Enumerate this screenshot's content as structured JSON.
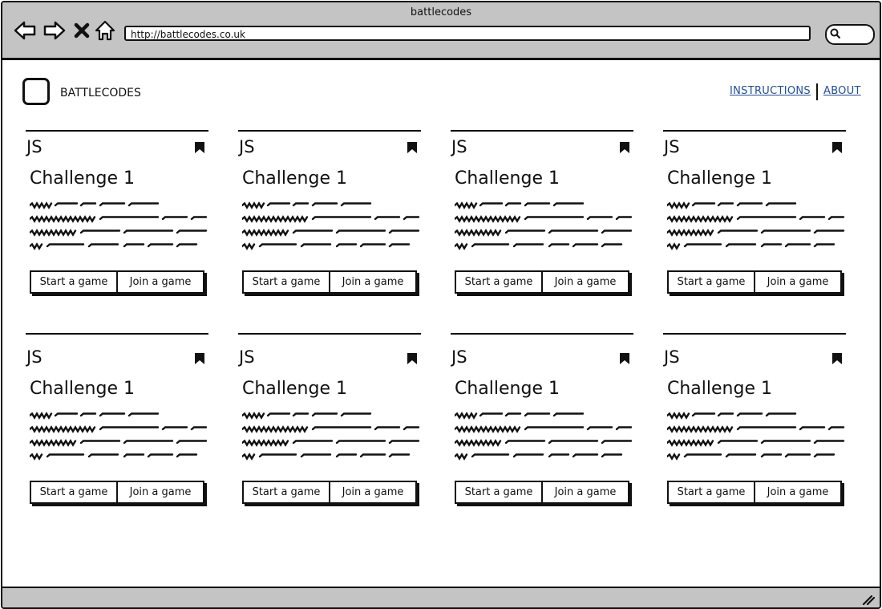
{
  "window": {
    "title": "battlecodes"
  },
  "browser": {
    "url": "http://battlecodes.co.uk",
    "icons": [
      "back-arrow-icon",
      "forward-arrow-icon",
      "close-icon",
      "home-icon",
      "search-icon"
    ]
  },
  "header": {
    "brand": "BATTLECODES",
    "nav": [
      {
        "label": "INSTRUCTIONS"
      },
      {
        "label": "ABOUT"
      }
    ]
  },
  "cards": [
    {
      "lang": "JS",
      "title": "Challenge 1",
      "start_label": "Start a game",
      "join_label": "Join a game"
    },
    {
      "lang": "JS",
      "title": "Challenge 1",
      "start_label": "Start a game",
      "join_label": "Join a game"
    },
    {
      "lang": "JS",
      "title": "Challenge 1",
      "start_label": "Start a game",
      "join_label": "Join a game"
    },
    {
      "lang": "JS",
      "title": "Challenge 1",
      "start_label": "Start a game",
      "join_label": "Join a game"
    },
    {
      "lang": "JS",
      "title": "Challenge 1",
      "start_label": "Start a game",
      "join_label": "Join a game"
    },
    {
      "lang": "JS",
      "title": "Challenge 1",
      "start_label": "Start a game",
      "join_label": "Join a game"
    },
    {
      "lang": "JS",
      "title": "Challenge 1",
      "start_label": "Start a game",
      "join_label": "Join a game"
    },
    {
      "lang": "JS",
      "title": "Challenge 1",
      "start_label": "Start a game",
      "join_label": "Join a game"
    }
  ],
  "colors": {
    "chrome": "#c4c4c4",
    "link": "#1f4e9c",
    "ink": "#111111"
  }
}
